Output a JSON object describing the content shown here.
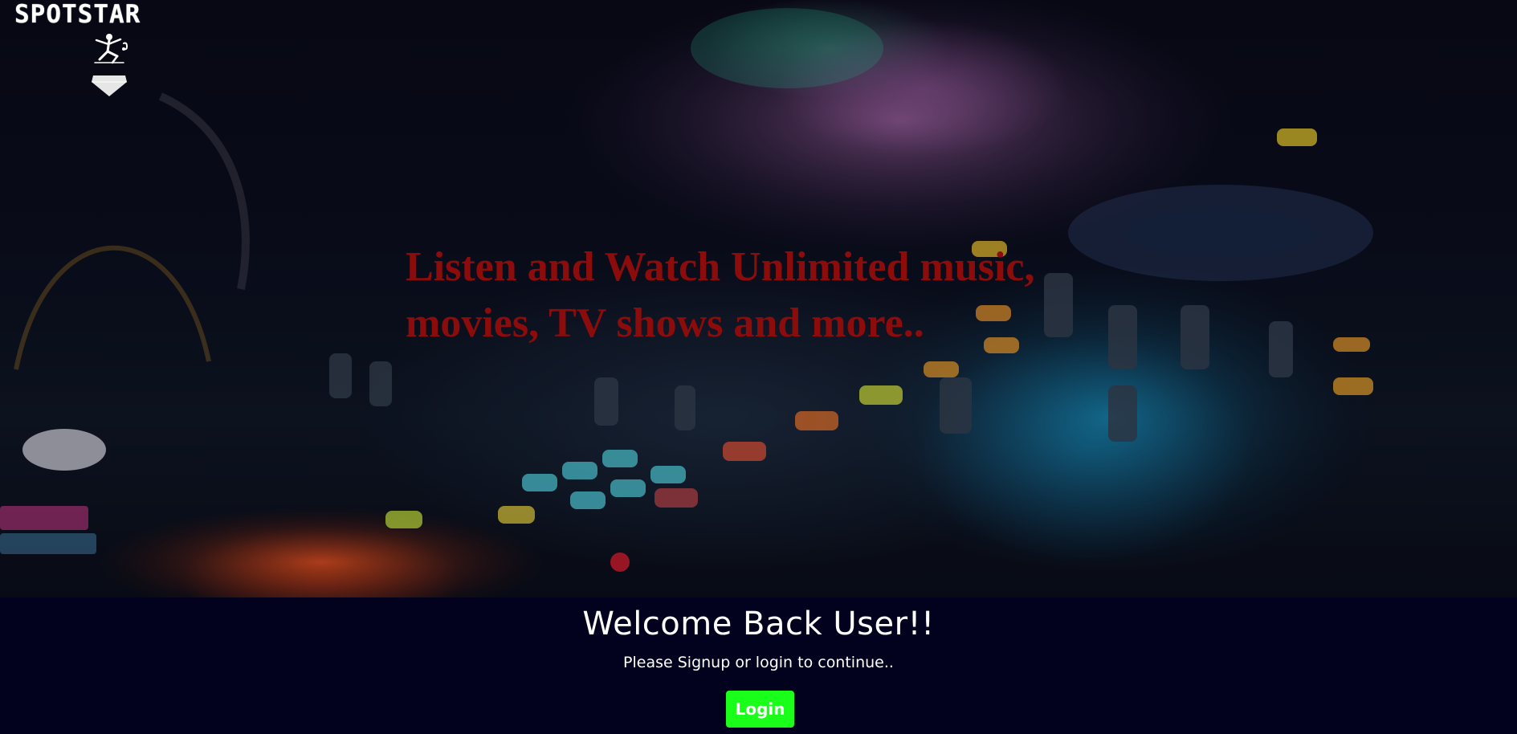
{
  "brand": {
    "name": "SPOTSTAR",
    "icons": [
      "dancer-icon",
      "diamond-icon"
    ]
  },
  "hero": {
    "headline_line1": "Listen and Watch Unlimited music,",
    "headline_line2": "movies, TV shows and more.."
  },
  "welcome": {
    "title": "Welcome Back User!!",
    "subtitle": "Please Signup or login to continue..",
    "login_label": "Login"
  },
  "colors": {
    "background": "#02021e",
    "headline": "#8c0c0c",
    "login_button": "#19ff19",
    "text": "#ffffff"
  }
}
